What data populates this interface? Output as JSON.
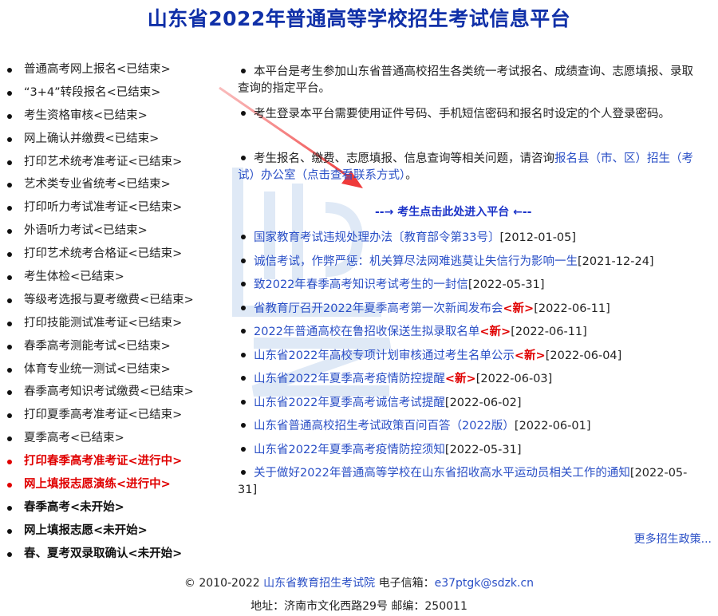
{
  "title": "山东省2022年普通高等学校招生考试信息平台",
  "menu": [
    {
      "label": "普通高考网上报名<已结束>",
      "state": "done"
    },
    {
      "label": "“3+4”转段报名<已结束>",
      "state": "done"
    },
    {
      "label": "考生资格审核<已结束>",
      "state": "done"
    },
    {
      "label": "网上确认并缴费<已结束>",
      "state": "done"
    },
    {
      "label": "打印艺术统考准考证<已结束>",
      "state": "done"
    },
    {
      "label": "艺术类专业省统考<已结束>",
      "state": "done"
    },
    {
      "label": "打印听力考试准考证<已结束>",
      "state": "done"
    },
    {
      "label": "外语听力考试<已结束>",
      "state": "done"
    },
    {
      "label": "打印艺术统考合格证<已结束>",
      "state": "done"
    },
    {
      "label": "考生体检<已结束>",
      "state": "done"
    },
    {
      "label": "等级考选报与夏考缴费<已结束>",
      "state": "done"
    },
    {
      "label": "打印技能测试准考证<已结束>",
      "state": "done"
    },
    {
      "label": "春季高考测能考试<已结束>",
      "state": "done"
    },
    {
      "label": "体育专业统一测试<已结束>",
      "state": "done"
    },
    {
      "label": "春季高考知识考试缴费<已结束>",
      "state": "done"
    },
    {
      "label": "打印夏季高考准考证<已结束>",
      "state": "done"
    },
    {
      "label": "夏季高考<已结束>",
      "state": "done"
    },
    {
      "label": "打印春季高考准考证<进行中>",
      "state": "active"
    },
    {
      "label": "网上填报志愿演练<进行中>",
      "state": "active"
    },
    {
      "label": "春季高考<未开始>",
      "state": "pending"
    },
    {
      "label": "网上填报志愿<未开始>",
      "state": "pending"
    },
    {
      "label": "春、夏考双录取确认<未开始>",
      "state": "pending"
    }
  ],
  "notices": {
    "n1": "本平台是考生参加山东省普通高校招生各类统一考试报名、成绩查询、志愿填报、录取查询的指定平台。",
    "n2": "考生登录本平台需要使用证件号码、手机短信密码和报名时设定的个人登录密码。",
    "n3_prefix": "考生报名、缴费、志愿填报、信息查询等相关问题，请咨询",
    "n3_link": "报名县（市、区）招生（考试）办公室（点击查看联系方式）",
    "n3_suffix": "。"
  },
  "enter_link": "--→ 考生点击此处进入平台 ←--",
  "news": [
    {
      "title": "国家教育考试违规处理办法〔教育部令第33号〕",
      "is_new": false,
      "date": "[2012-01-05]"
    },
    {
      "title": "诚信考试，作弊严惩：机关算尽法网难逃莫让失信行为影响一生",
      "is_new": false,
      "date": "[2021-12-24]"
    },
    {
      "title": "致2022年春季高考知识考试考生的一封信",
      "is_new": false,
      "date": "[2022-05-31]"
    },
    {
      "title": "省教育厅召开2022年夏季高考第一次新闻发布会",
      "is_new": true,
      "date": "[2022-06-11]"
    },
    {
      "title": "2022年普通高校在鲁招收保送生拟录取名单",
      "is_new": true,
      "date": "[2022-06-11]"
    },
    {
      "title": "山东省2022年高校专项计划审核通过考生名单公示",
      "is_new": true,
      "date": "[2022-06-04]"
    },
    {
      "title": "山东省2022年夏季高考疫情防控提醒",
      "is_new": true,
      "date": "[2022-06-03]"
    },
    {
      "title": "山东省2022年夏季高考诚信考试提醒",
      "is_new": false,
      "date": "[2022-06-02]"
    },
    {
      "title": "山东省普通高校招生考试政策百问百答（2022版）",
      "is_new": false,
      "date": "[2022-06-01]"
    },
    {
      "title": "山东省2022年夏季高考疫情防控须知",
      "is_new": false,
      "date": "[2022-05-31]"
    },
    {
      "title": "关于做好2022年普通高等学校在山东省招收高水平运动员相关工作的通知",
      "is_new": false,
      "date": "[2022-05-31]"
    }
  ],
  "new_tag": "<新>",
  "more_link": "更多招生政策...",
  "footer": {
    "copyright": "© 2010-2022",
    "org_link": "山东省教育招生考试院",
    "email_label": "电子信箱：",
    "email": "e37ptgk@sdzk.cn",
    "address": "地址：济南市文化西路29号 邮编：250011"
  },
  "colors": {
    "title": "#1030a8",
    "link": "#2a4fc6",
    "active": "#e00000",
    "arrow": "#f05050"
  }
}
